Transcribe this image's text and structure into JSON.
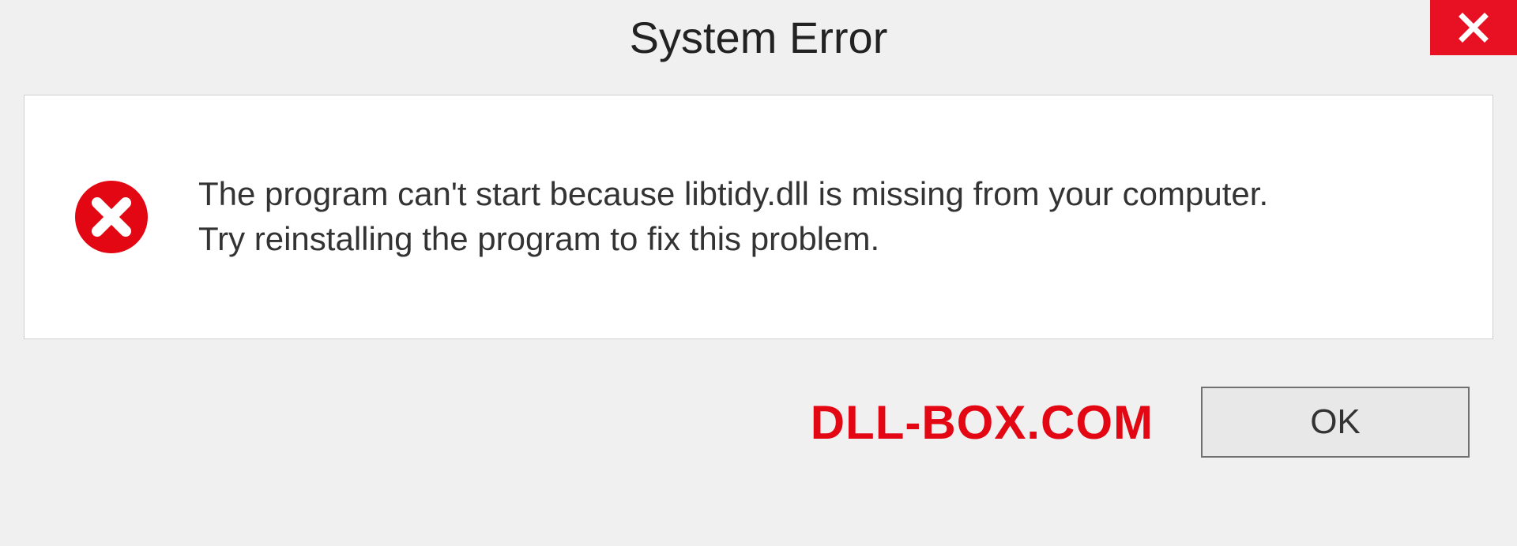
{
  "titlebar": {
    "title": "System Error"
  },
  "message": {
    "line1": "The program can't start because libtidy.dll is missing from your computer.",
    "line2": "Try reinstalling the program to fix this problem."
  },
  "footer": {
    "watermark": "DLL-BOX.COM",
    "ok_label": "OK"
  },
  "colors": {
    "close_bg": "#e81123",
    "error_red": "#e30613"
  }
}
